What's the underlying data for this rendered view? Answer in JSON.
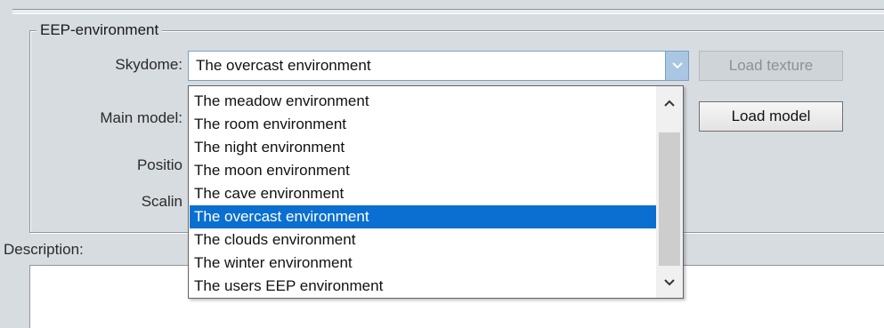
{
  "group": {
    "title": "EEP-environment"
  },
  "labels": {
    "skydome": "Skydome:",
    "main_model": "Main model:",
    "position": "Positio",
    "scaling": "Scalin"
  },
  "skydome_combo": {
    "value": "The overcast environment",
    "options": [
      "The meadow environment",
      "The room environment",
      "The night environment",
      "The moon environment",
      "The cave environment",
      "The overcast environment",
      "The clouds environment",
      "The winter environment",
      "The users EEP environment"
    ],
    "selected_index": 5
  },
  "buttons": {
    "load_texture": "Load texture",
    "load_model": "Load model"
  },
  "description": {
    "label": "Description:",
    "value": ""
  },
  "colors": {
    "selection": "#0a6fd1",
    "combo_arrow": "#a9c6e3",
    "background": "#d7dce1"
  },
  "icons": [
    "chevron-down-icon",
    "scroll-up-icon",
    "scroll-down-icon"
  ]
}
